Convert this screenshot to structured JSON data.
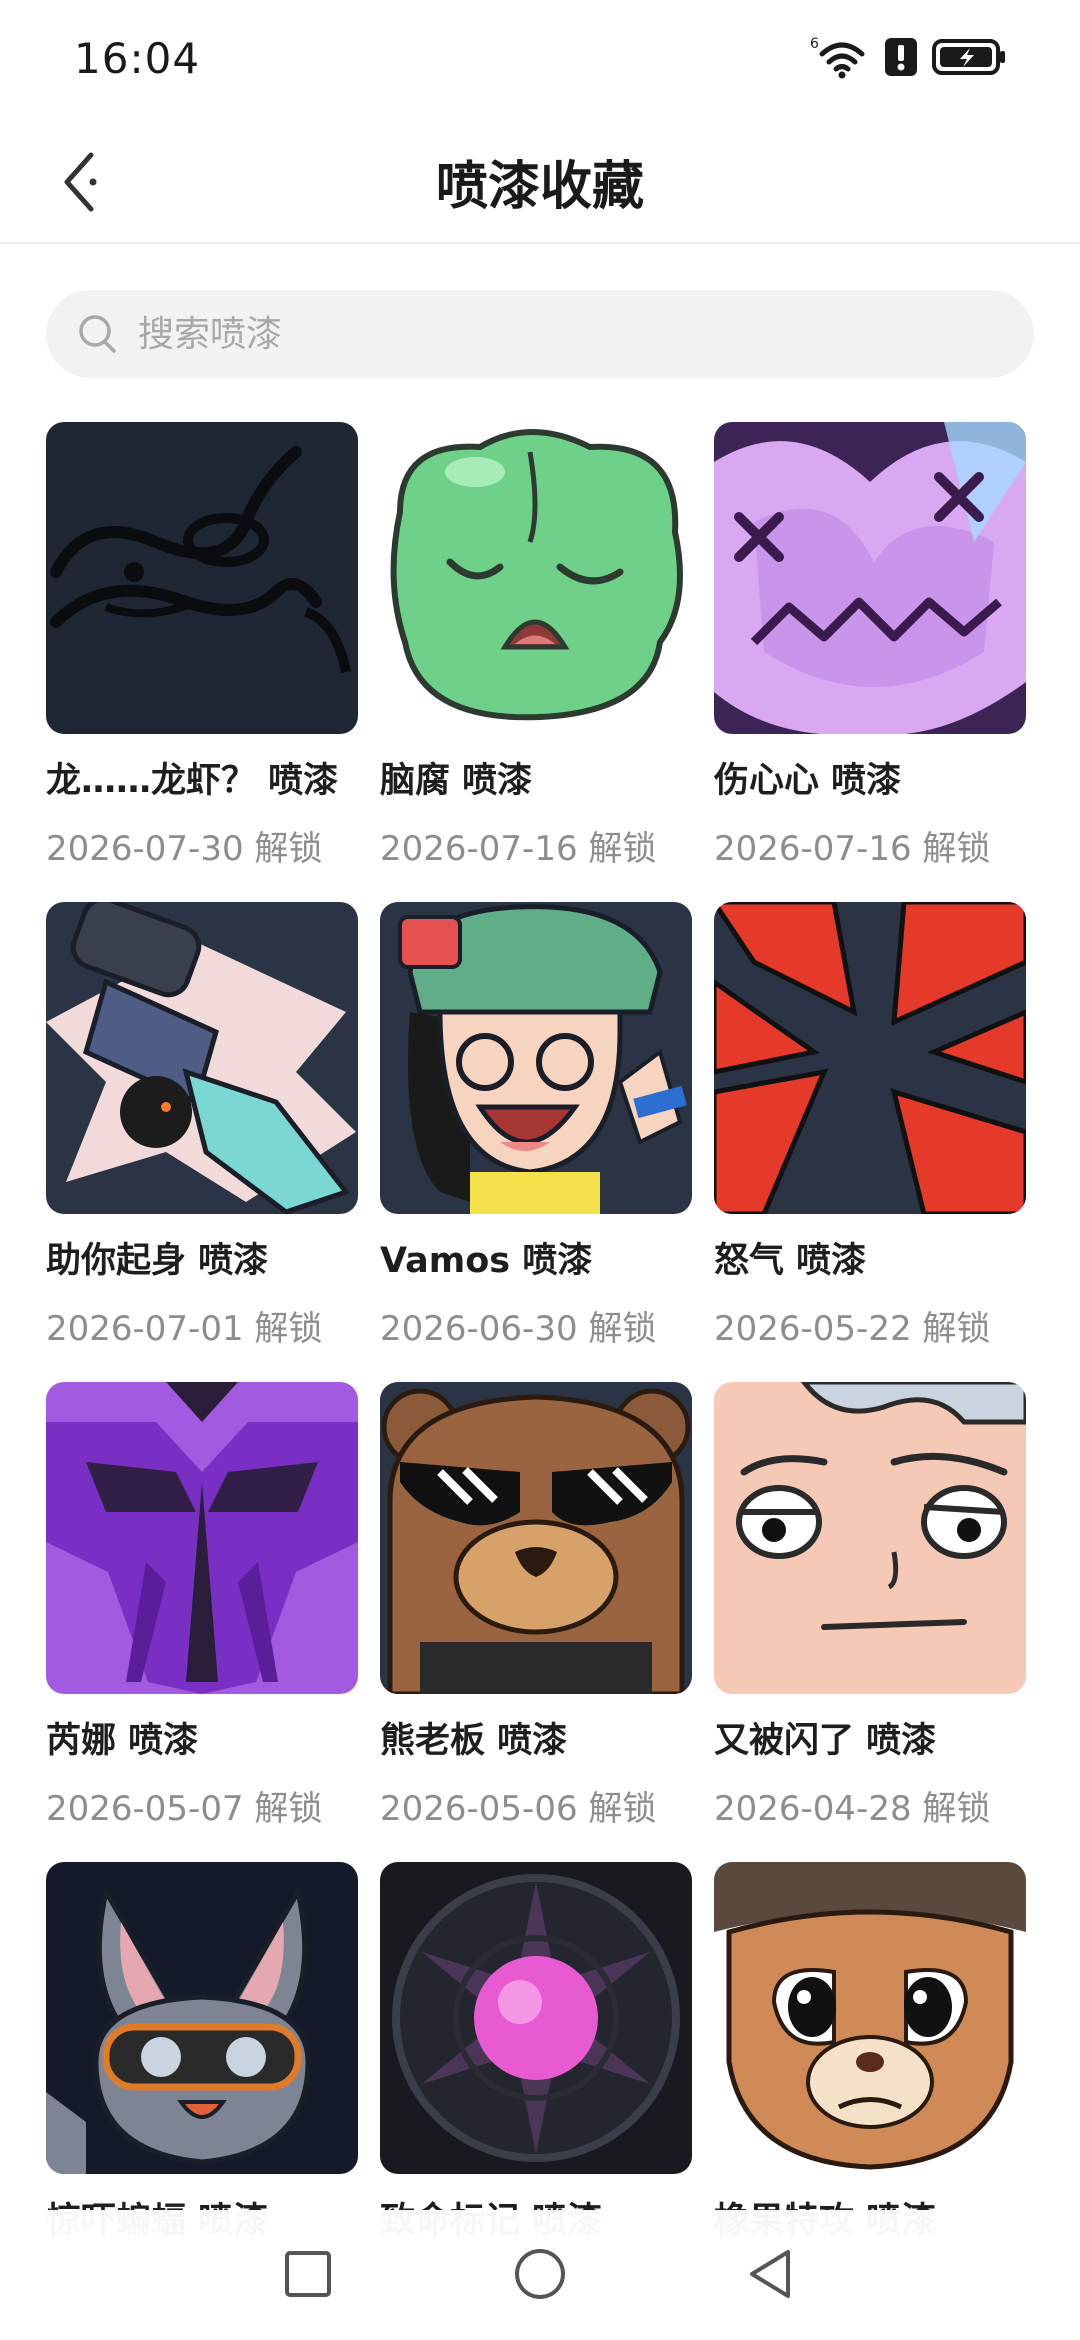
{
  "status_bar": {
    "time": "16:04",
    "wifi_badge": "6",
    "icons": [
      "wifi-icon",
      "alert-icon",
      "battery-charging-icon"
    ]
  },
  "header": {
    "title": "喷漆收藏",
    "back_icon": "back-arrow-icon"
  },
  "search": {
    "placeholder": "搜索喷漆",
    "value": ""
  },
  "sprays": [
    {
      "name": "龙……龙虾？ 喷漆",
      "date": "2026-07-30 解锁",
      "art": "doodle"
    },
    {
      "name": "脑腐 喷漆",
      "date": "2026-07-16 解锁",
      "art": "green-brain"
    },
    {
      "name": "伤心心 喷漆",
      "date": "2026-07-16 解锁",
      "art": "purple-heart"
    },
    {
      "name": "助你起身 喷漆",
      "date": "2026-07-01 解锁",
      "art": "robot-arm"
    },
    {
      "name": "Vamos 喷漆",
      "date": "2026-06-30 解锁",
      "art": "laughing-girl"
    },
    {
      "name": "怒气 喷漆",
      "date": "2026-05-22 解锁",
      "art": "red-burst"
    },
    {
      "name": "芮娜 喷漆",
      "date": "2026-05-07 解锁",
      "art": "purple-emblem"
    },
    {
      "name": "熊老板 喷漆",
      "date": "2026-05-06 解锁",
      "art": "bear-sunglasses"
    },
    {
      "name": "又被闪了 喷漆",
      "date": "2026-04-28 解锁",
      "art": "blank-face"
    },
    {
      "name": "惊吓蝙蝠 喷漆",
      "date": "",
      "art": "bat"
    },
    {
      "name": "致命标记 喷漆",
      "date": "",
      "art": "pink-orb"
    },
    {
      "name": "橡果特攻 喷漆",
      "date": "",
      "art": "squirrel"
    }
  ],
  "nav_bar": {
    "icons": [
      "recents-square-icon",
      "home-circle-icon",
      "back-triangle-icon"
    ]
  },
  "colors": {
    "background": "#ffffff",
    "search_bg": "#f2f2f2",
    "placeholder": "#a8a8a8",
    "date_text": "#8d8d8d",
    "title_text": "#1a1a1a"
  }
}
